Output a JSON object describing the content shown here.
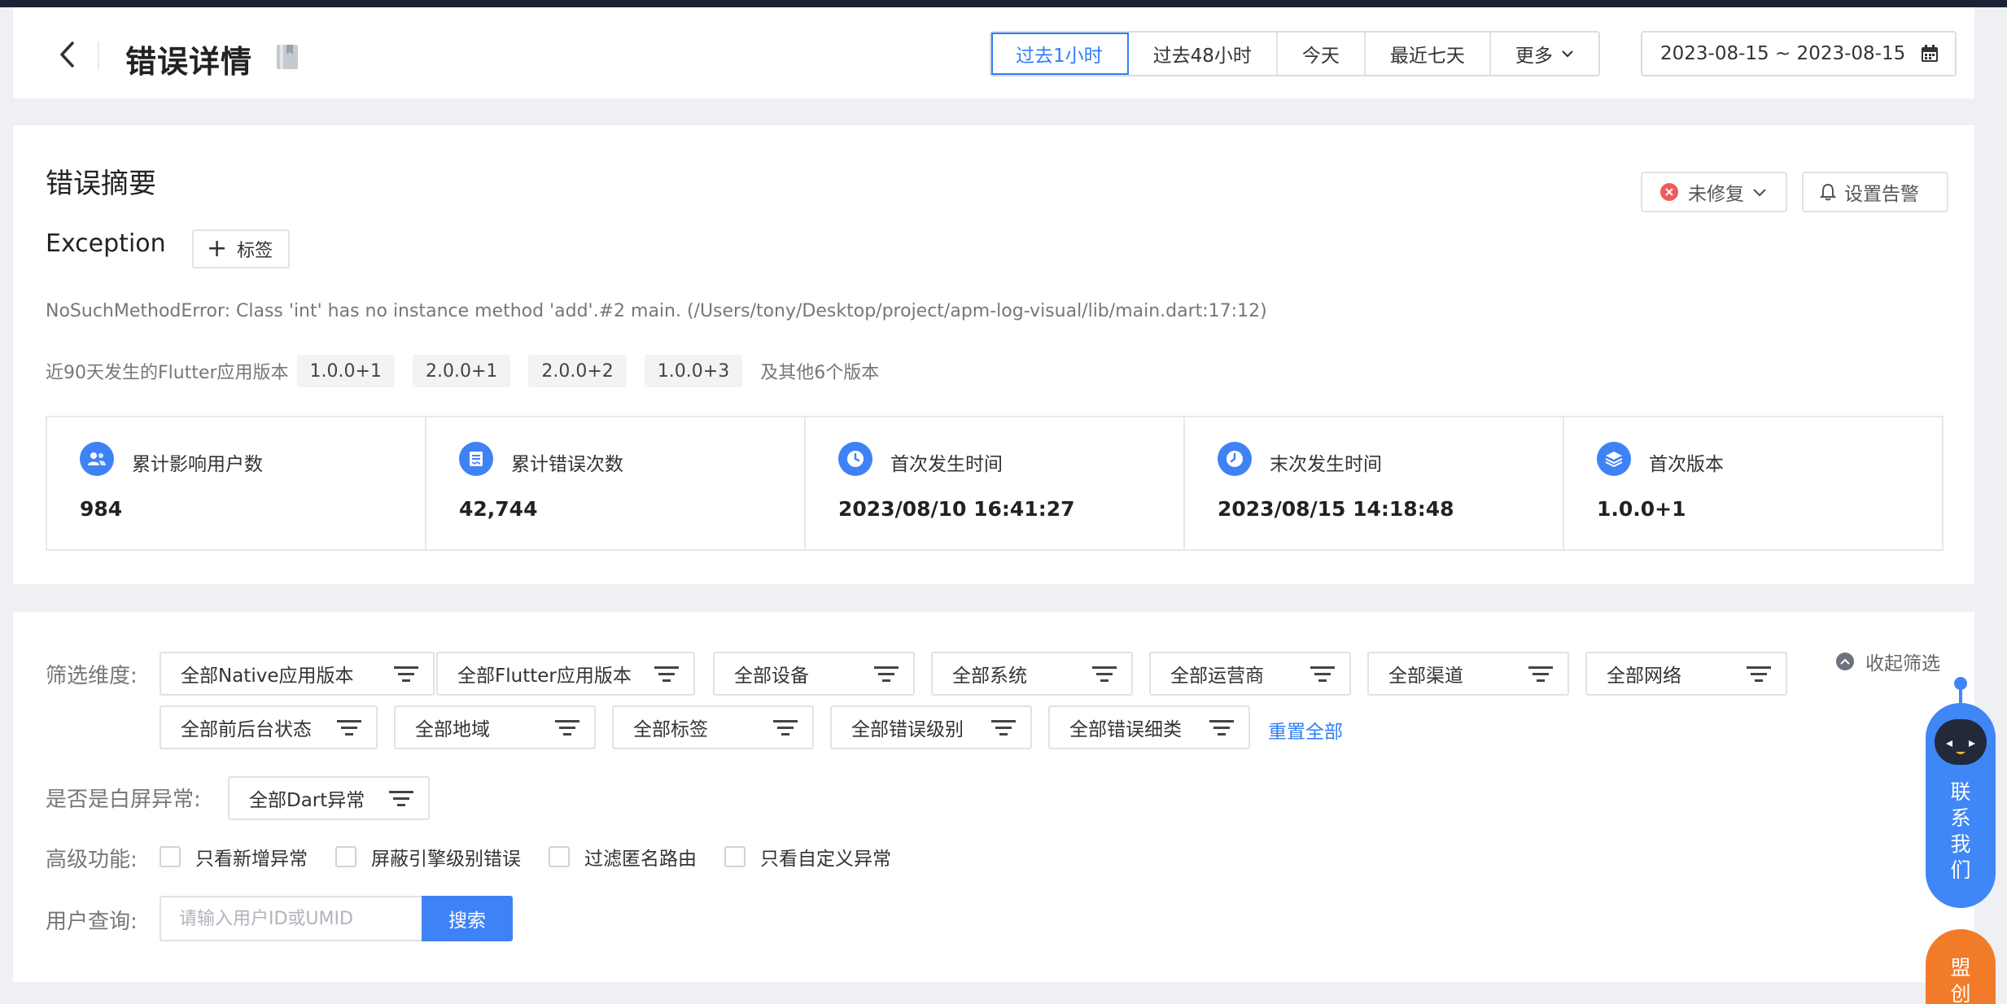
{
  "header": {
    "title": "错误详情",
    "time_ranges": [
      {
        "label": "过去1小时",
        "active": true
      },
      {
        "label": "过去48小时",
        "active": false
      },
      {
        "label": "今天",
        "active": false
      },
      {
        "label": "最近七天",
        "active": false
      },
      {
        "label": "更多",
        "active": false
      }
    ],
    "date_range": "2023-08-15 ~ 2023-08-15"
  },
  "summary": {
    "title": "错误摘要",
    "status_label": "未修复",
    "alert_label": "设置告警",
    "exception_name": "Exception",
    "tag_label": "标签",
    "error_message": "NoSuchMethodError: Class 'int' has no instance method 'add'.#2 main. (/Users/tony/Desktop/project/apm-log-visual/lib/main.dart:17:12)",
    "versions_label": "近90天发生的Flutter应用版本",
    "versions": [
      "1.0.0+1",
      "2.0.0+1",
      "2.0.0+2",
      "1.0.0+3"
    ],
    "versions_more": "及其他6个版本",
    "stats": [
      {
        "icon": "users-icon",
        "label": "累计影响用户数",
        "value": "984"
      },
      {
        "icon": "error-count-icon",
        "label": "累计错误次数",
        "value": "42,744"
      },
      {
        "icon": "clock-icon",
        "label": "首次发生时间",
        "value": "2023/08/10 16:41:27"
      },
      {
        "icon": "clock-icon",
        "label": "末次发生时间",
        "value": "2023/08/15 14:18:48"
      },
      {
        "icon": "layers-icon",
        "label": "首次版本",
        "value": "1.0.0+1"
      }
    ]
  },
  "filters": {
    "dimension_label": "筛选维度:",
    "chips_row1": [
      "全部Native应用版本",
      "全部Flutter应用版本",
      "全部设备",
      "全部系统",
      "全部运营商",
      "全部渠道",
      "全部网络"
    ],
    "chips_row2": [
      "全部前后台状态",
      "全部地域",
      "全部标签",
      "全部错误级别",
      "全部错误细类"
    ],
    "reset_label": "重置全部",
    "collapse_label": "收起筛选",
    "white_screen_label": "是否是白屏异常:",
    "white_screen_value": "全部Dart异常",
    "advanced_label": "高级功能:",
    "checkboxes": [
      "只看新增异常",
      "屏蔽引擎级别错误",
      "过滤匿名路由",
      "只看自定义异常"
    ],
    "user_query_label": "用户查询:",
    "user_query_placeholder": "请输入用户ID或UMID",
    "search_label": "搜索"
  },
  "widgets": {
    "contact_label": "联系我们",
    "mengchuang_label": "盟创"
  },
  "colors": {
    "accent": "#2f7ef7",
    "status_red": "#ef5b5b",
    "widget_orange": "#f27b2a",
    "topbar": "#1b2233"
  }
}
